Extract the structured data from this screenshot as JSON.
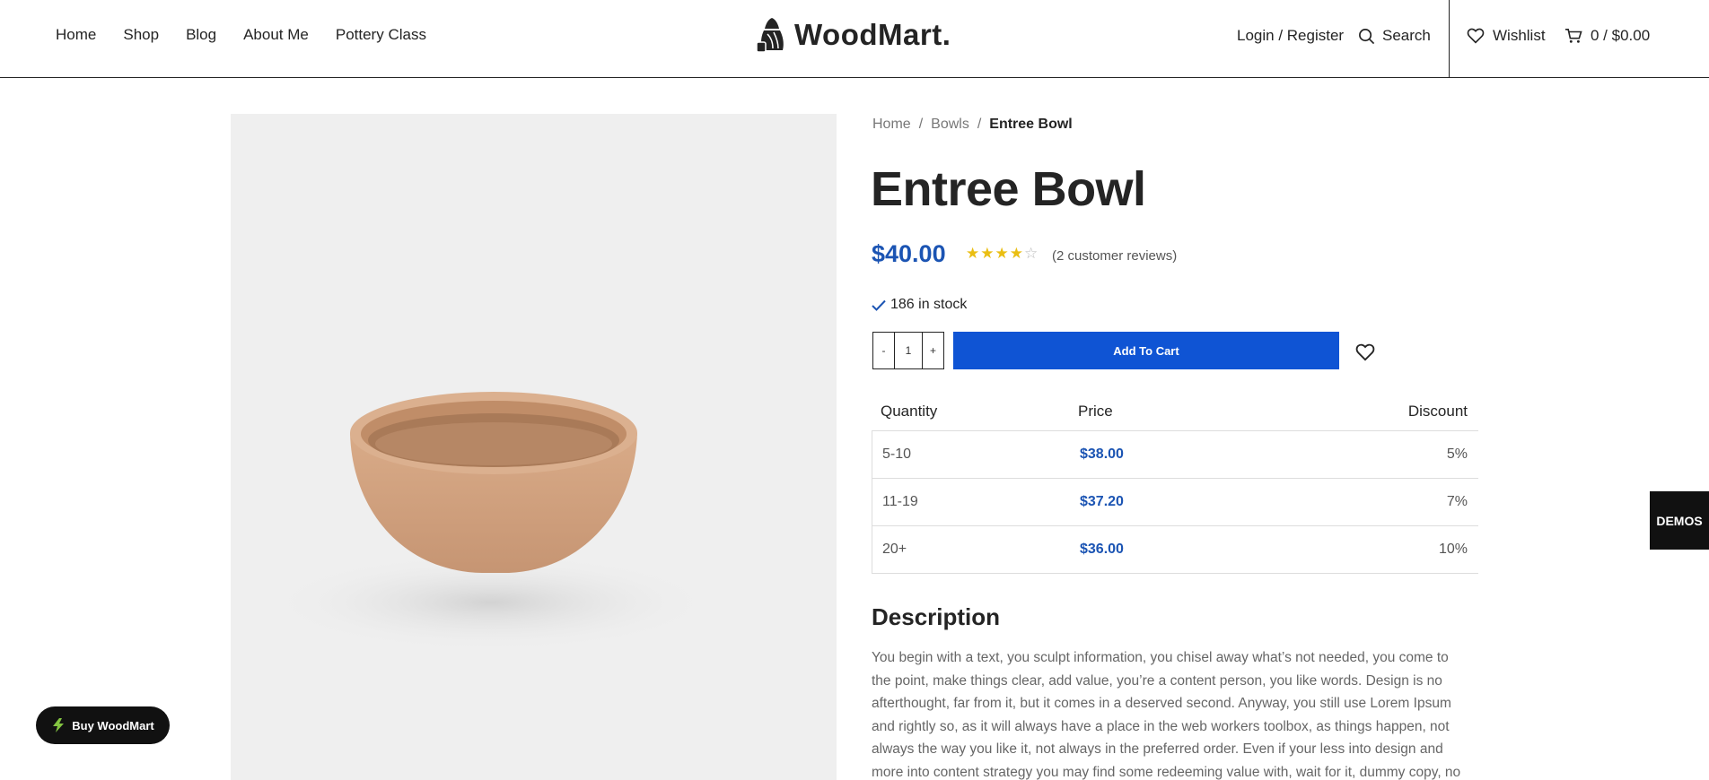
{
  "nav": {
    "items": [
      "Home",
      "Shop",
      "Blog",
      "About Me",
      "Pottery Class"
    ]
  },
  "logo": {
    "text": "WoodMart."
  },
  "header": {
    "login": "Login / Register",
    "search": "Search",
    "wishlist": "Wishlist",
    "cart": "0 / $0.00"
  },
  "breadcrumb": {
    "home": "Home",
    "sep": "/",
    "category": "Bowls",
    "current": "Entree Bowl"
  },
  "product": {
    "title": "Entree Bowl",
    "price": "$40.00",
    "rating": 4,
    "rating_max": 5,
    "reviews": "(2 customer reviews)",
    "stock": "186 in stock",
    "qty_minus": "-",
    "qty_value": "1",
    "qty_plus": "+",
    "add_to_cart": "Add To Cart"
  },
  "pricing_table": {
    "headers": [
      "Quantity",
      "Price",
      "Discount"
    ],
    "rows": [
      [
        "5-10",
        "$38.00",
        "5%"
      ],
      [
        "11-19",
        "$37.20",
        "7%"
      ],
      [
        "20+",
        "$36.00",
        "10%"
      ]
    ]
  },
  "description": {
    "title": "Description",
    "text": "You begin with a text, you sculpt information, you chisel away what’s not needed, you come to the point, make things clear, add value, you’re a content person, you like words. Design is no afterthought, far from it, but it comes in a deserved second. Anyway, you still use Lorem Ipsum and rightly so, as it will always have a place in the web workers toolbox, as things happen, not always the way you like it, not always in the preferred order. Even if your less into design and more into content strategy you may find some redeeming value with, wait for it, dummy copy, no less."
  },
  "demos": {
    "label": "DEMOS"
  },
  "buy": {
    "label": "Buy WoodMart"
  },
  "colors": {
    "accent": "#1b54b3",
    "button": "#0f54d4",
    "star": "#eabe12",
    "buy_icon": "#83c441"
  }
}
